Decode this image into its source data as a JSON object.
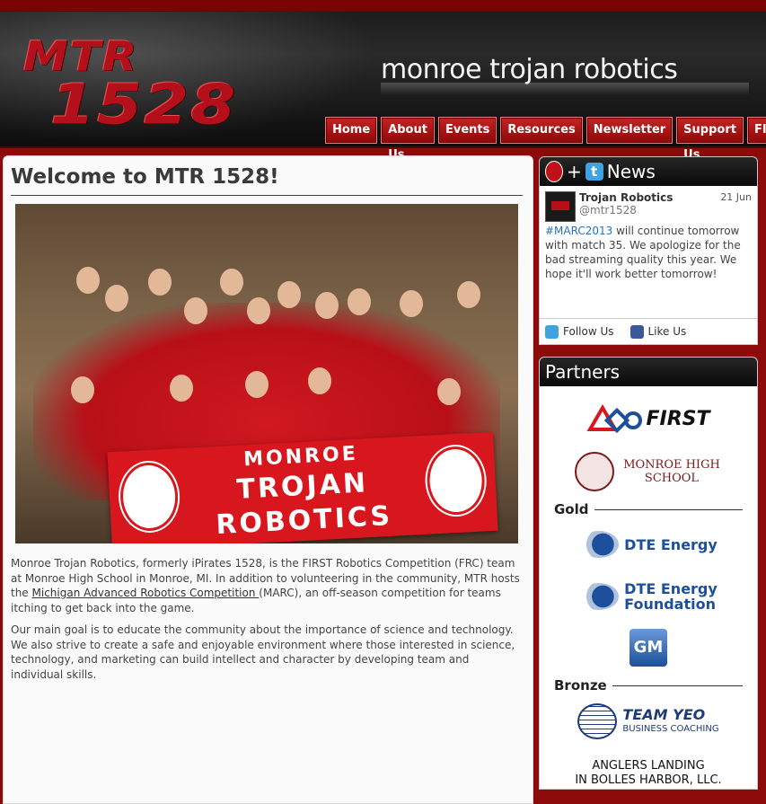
{
  "header": {
    "logo_line1": "MTR",
    "logo_line2": "1528",
    "site_title": "monroe trojan robotics"
  },
  "nav": [
    "Home",
    "About Us",
    "Events",
    "Resources",
    "Newsletter",
    "Support Us",
    "FIRST"
  ],
  "main": {
    "heading": "Welcome to MTR 1528!",
    "photo_banner": [
      "MONROE",
      "TROJAN",
      "ROBOTICS"
    ],
    "para1_a": "Monroe Trojan Robotics, formerly iPirates 1528, is the FIRST Robotics Competition (FRC) team at Monroe High School in Monroe, MI. In addition to volunteering in the community, MTR hosts the ",
    "para1_link": "Michigan Advanced Robotics Competition ",
    "para1_b": "(MARC), an off-season competition for teams itching to get back into the game.",
    "para2": "Our main goal is to educate the community about the importance of science and technology. We also strive to create a safe and enjoyable environment where those interested in science, technology, and marketing can build intellect and character by developing team and individual skills."
  },
  "news": {
    "title": "News",
    "tweet_name": "Trojan Robotics",
    "tweet_handle": "@mtr1528",
    "tweet_date": "21 Jun",
    "tweet_tag": "#MARC2013",
    "tweet_text": " will continue tomorrow with match 35. We apologize for the bad streaming quality this year. We hope it'll work better tomorrow!",
    "follow_label": "Follow Us",
    "like_label": "Like Us"
  },
  "partners": {
    "title": "Partners",
    "first_logo": "FIRST",
    "monroe_hs_logo": "MONROE HIGH SCHOOL",
    "tier_gold": "Gold",
    "dte_energy": "DTE Energy",
    "dte_foundation_1": "DTE Energy",
    "dte_foundation_2": "Foundation",
    "gm_logo": "GM",
    "tier_bronze": "Bronze",
    "teamyeo_1": "TEAM YEO",
    "teamyeo_2": "BUSINESS COACHING",
    "anglers_1": "ANGLERS LANDING",
    "anglers_2": "IN BOLLES HARBOR, LLC."
  },
  "colors": {
    "brand_red": "#b4101c",
    "page_bg": "#8d0a0a",
    "dte_blue": "#1d4f9c",
    "twitter_blue": "#2a73b5"
  }
}
